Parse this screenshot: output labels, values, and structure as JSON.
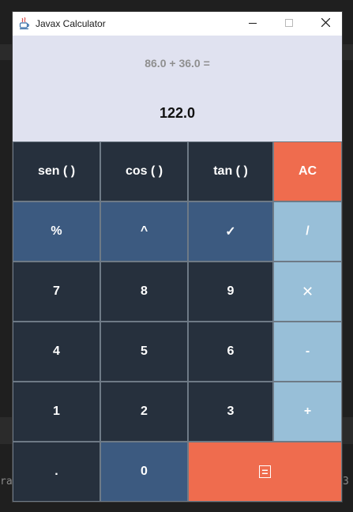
{
  "background": {
    "left_fragment": "ra",
    "right_fragment": "3"
  },
  "window": {
    "title": "Javax Calculator",
    "app_icon": "java-cup-icon",
    "controls": {
      "minimize_icon": "minimize-icon",
      "maximize_icon": "maximize-icon",
      "close_icon": "close-icon"
    }
  },
  "display": {
    "expression": "86.0 + 36.0 =",
    "result": "122.0"
  },
  "colors": {
    "dark_key": "#26303d",
    "function_key": "#3c5a80",
    "operator_key": "#98bfd8",
    "accent_key": "#ef6c4e",
    "display_bg": "#e0e2f0",
    "expression_text": "#8f8f8f"
  },
  "keys": {
    "sen": "sen ( )",
    "cos": "cos ( )",
    "tan": "tan ( )",
    "ac": "AC",
    "percent": "%",
    "power": "^",
    "sqrt": "✓",
    "divide": "/",
    "seven": "7",
    "eight": "8",
    "nine": "9",
    "multiply": "✕",
    "four": "4",
    "five": "5",
    "six": "6",
    "minus": "-",
    "one": "1",
    "two": "2",
    "three": "3",
    "plus": "+",
    "dot": ".",
    "zero": "0",
    "equals": "="
  }
}
